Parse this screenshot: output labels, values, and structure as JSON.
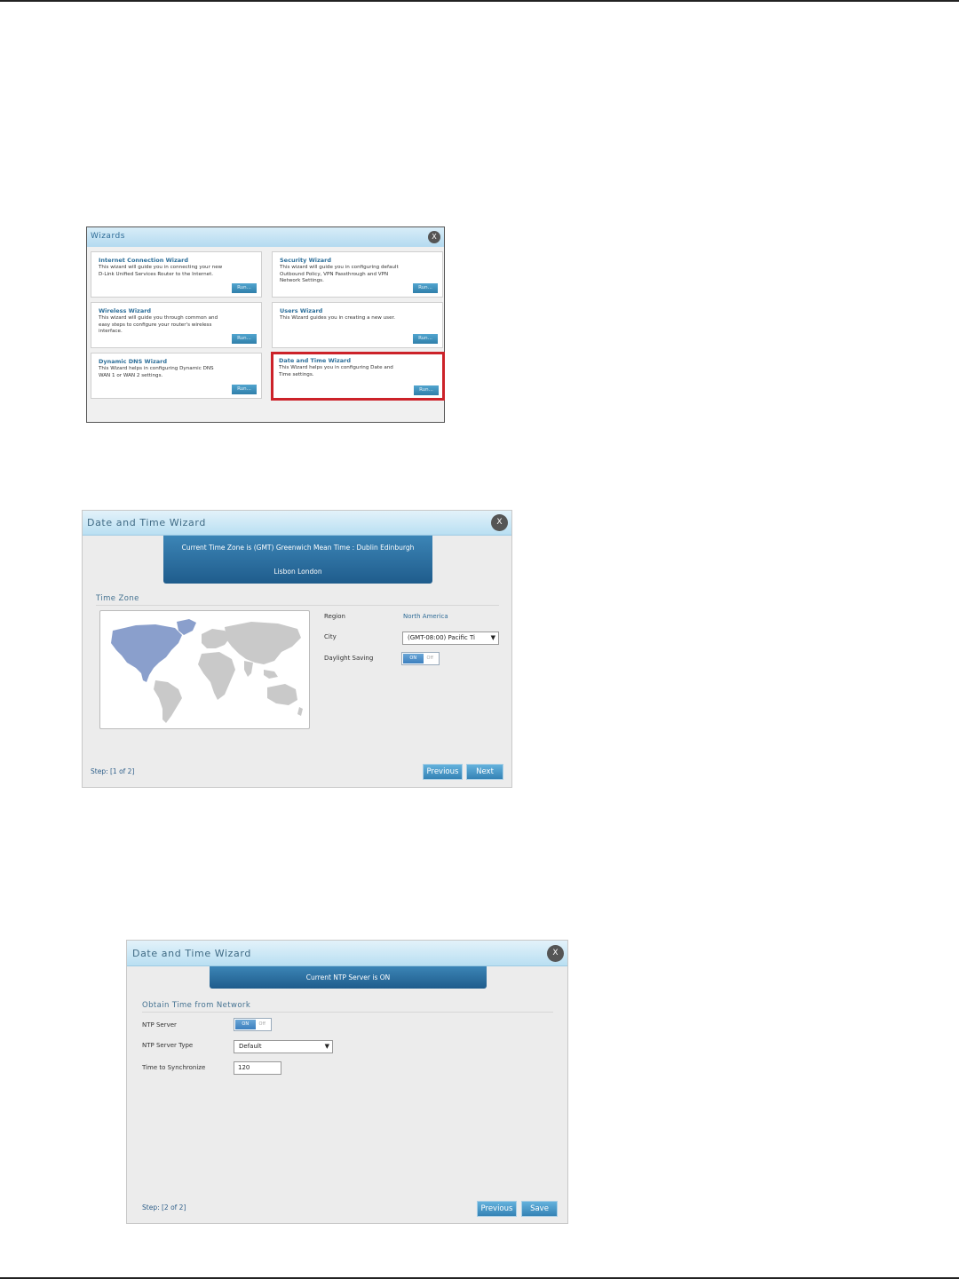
{
  "wizards_panel": {
    "title": "Wizards",
    "close_label": "X",
    "cards": [
      {
        "title": "Internet Connection Wizard",
        "description": "This wizard will guide you in connecting your new D-Link Unified Services Router to the Internet.",
        "button": "Run..."
      },
      {
        "title": "Security Wizard",
        "description": "This wizard will guide you in configuring default Outbound Policy, VPN Passthrough and VPN Network Settings.",
        "button": "Run..."
      },
      {
        "title": "Wireless Wizard",
        "description": "This wizard will guide you through common and easy steps to configure your router's wireless interface.",
        "button": "Run..."
      },
      {
        "title": "Users Wizard",
        "description": "This Wizard guides you in creating a new user.",
        "button": "Run..."
      },
      {
        "title": "Dynamic DNS Wizard",
        "description": "This Wizard helps in configuring Dynamic DNS WAN 1 or WAN 2 settings.",
        "button": "Run..."
      },
      {
        "title": "Date and Time Wizard",
        "description": "This Wizard helps you in configuring Date and Time settings.",
        "button": "Run..."
      }
    ],
    "highlight_color": "#cc2229"
  },
  "step1": {
    "title": "Date and Time Wizard",
    "close_label": "X",
    "banner_line1": "Current Time Zone is (GMT) Greenwich Mean Time : Dublin Edinburgh",
    "banner_line2": "Lisbon London",
    "section_title": "Time Zone",
    "region_label": "Region",
    "region_value": "North America",
    "city_label": "City",
    "city_value": "(GMT-08:00) Pacific Ti",
    "daylight_label": "Daylight Saving",
    "daylight_on": "ON",
    "daylight_off": "Off",
    "step_text": "Step: [1 of 2]",
    "previous_button": "Previous",
    "next_button": "Next"
  },
  "step2": {
    "title": "Date and Time Wizard",
    "close_label": "X",
    "banner": "Current NTP Server is ON",
    "section_title": "Obtain Time from Network",
    "ntp_server_label": "NTP Server",
    "ntp_on": "ON",
    "ntp_off": "Off",
    "ntp_type_label": "NTP Server Type",
    "ntp_type_value": "Default",
    "sync_label": "Time to Synchronize",
    "sync_value": "120",
    "step_text": "Step: [2 of 2]",
    "previous_button": "Previous",
    "save_button": "Save"
  },
  "colors": {
    "accent_blue": "#2f6c97",
    "button_blue": "#3583b5",
    "map_highlight": "#8a9fcc",
    "map_land": "#c9c9c9"
  }
}
